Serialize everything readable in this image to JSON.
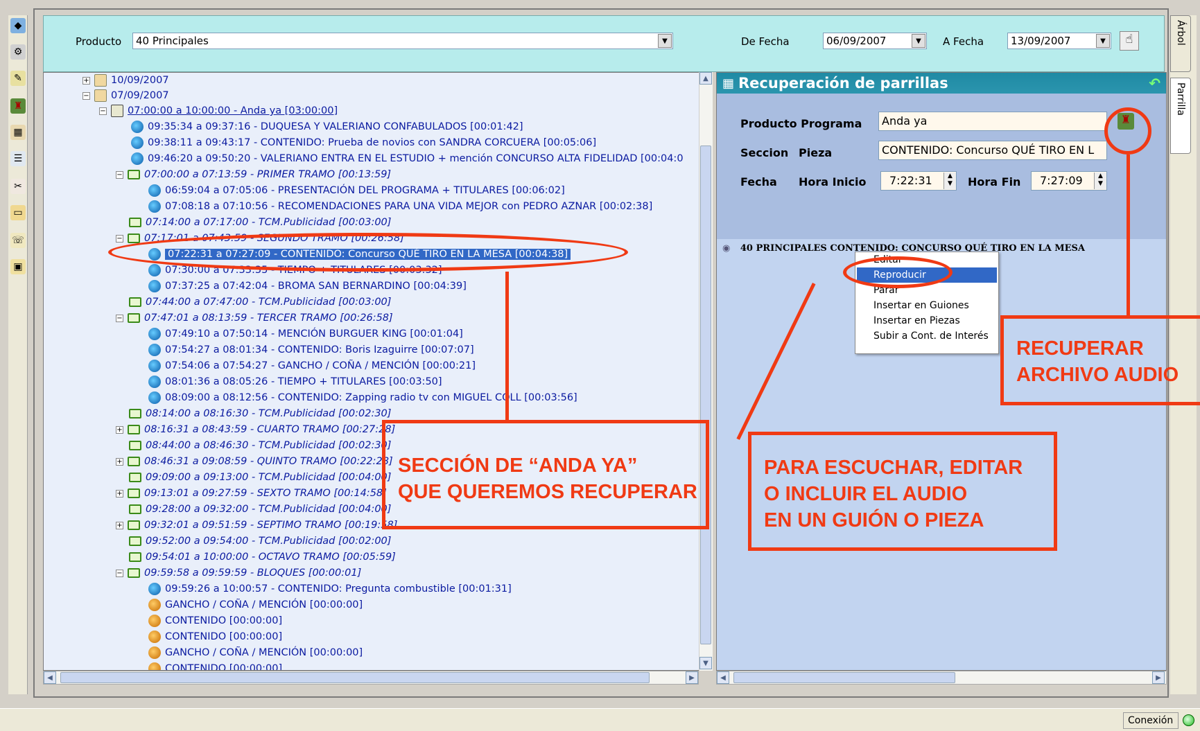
{
  "filter": {
    "producto_label": "Producto",
    "producto_value": "40 Principales",
    "de_fecha_label": "De Fecha",
    "de_fecha_value": "06/09/2007",
    "a_fecha_label": "A Fecha",
    "a_fecha_value": "13/09/2007"
  },
  "tree": {
    "rows": [
      {
        "text": "10/09/2007"
      },
      {
        "text": "07/09/2007"
      },
      {
        "text": "07:00:00 a 10:00:00 - Anda ya [03:00:00]"
      },
      {
        "text": "09:35:34 a 09:37:16 - DUQUESA Y VALERIANO CONFABULADOS [00:01:42]"
      },
      {
        "text": "09:38:11 a 09:43:17 - CONTENIDO: Prueba de novios con SANDRA CORCUERA [00:05:06]"
      },
      {
        "text": "09:46:20 a 09:50:20 - VALERIANO ENTRA EN EL ESTUDIO + mención CONCURSO ALTA FIDELIDAD [00:04:0"
      },
      {
        "text": "07:00:00 a 07:13:59 - PRIMER TRAMO [00:13:59]"
      },
      {
        "text": "06:59:04 a 07:05:06 - PRESENTACIÓN DEL PROGRAMA + TITULARES [00:06:02]"
      },
      {
        "text": "07:08:18 a 07:10:56 - RECOMENDACIONES PARA UNA VIDA MEJOR con PEDRO AZNAR [00:02:38]"
      },
      {
        "text": "07:14:00 a 07:17:00 - TCM.Publicidad [00:03:00]"
      },
      {
        "text": "07:17:01 a 07:43:59 - SEGUNDO TRAMO [00:26:58]"
      },
      {
        "text": "07:22:31 a 07:27:09 - CONTENIDO: Concurso QUÉ TIRO EN LA MESA [00:04:38]"
      },
      {
        "text": "07:30:00 a 07:33:35 - TIEMPO + TITULARES [00:03:32]"
      },
      {
        "text": "07:37:25 a 07:42:04 - BROMA SAN BERNARDINO [00:04:39]"
      },
      {
        "text": "07:44:00 a 07:47:00 - TCM.Publicidad [00:03:00]"
      },
      {
        "text": "07:47:01 a 08:13:59 - TERCER TRAMO [00:26:58]"
      },
      {
        "text": "07:49:10 a 07:50:14 - MENCIÓN BURGUER KING [00:01:04]"
      },
      {
        "text": "07:54:27 a 08:01:34 - CONTENIDO: Boris Izaguirre [00:07:07]"
      },
      {
        "text": "07:54:06 a 07:54:27 - GANCHO / COÑA / MENCIÓN [00:00:21]"
      },
      {
        "text": "08:01:36 a 08:05:26 - TIEMPO + TITULARES [00:03:50]"
      },
      {
        "text": "08:09:00 a 08:12:56 - CONTENIDO: Zapping radio tv con MIGUEL COLL [00:03:56]"
      },
      {
        "text": "08:14:00 a 08:16:30 - TCM.Publicidad [00:02:30]"
      },
      {
        "text": "08:16:31 a 08:43:59 - CUARTO TRAMO [00:27:28]"
      },
      {
        "text": "08:44:00 a 08:46:30 - TCM.Publicidad [00:02:30]"
      },
      {
        "text": "08:46:31 a 09:08:59 - QUINTO TRAMO [00:22:28]"
      },
      {
        "text": "09:09:00 a 09:13:00 - TCM.Publicidad [00:04:00]"
      },
      {
        "text": "09:13:01 a 09:27:59 - SEXTO TRAMO [00:14:58]"
      },
      {
        "text": "09:28:00 a 09:32:00 - TCM.Publicidad [00:04:00]"
      },
      {
        "text": "09:32:01 a 09:51:59 - SEPTIMO TRAMO [00:19:58]"
      },
      {
        "text": "09:52:00 a 09:54:00 - TCM.Publicidad [00:02:00]"
      },
      {
        "text": "09:54:01 a 10:00:00 - OCTAVO TRAMO [00:05:59]"
      },
      {
        "text": "09:59:58 a 09:59:59 - BLOQUES [00:00:01]"
      },
      {
        "text": "09:59:26 a 10:00:57 - CONTENIDO: Pregunta combustible [00:01:31]"
      },
      {
        "text": "GANCHO / COÑA / MENCIÓN [00:00:00]"
      },
      {
        "text": "CONTENIDO [00:00:00]"
      },
      {
        "text": "CONTENIDO [00:00:00]"
      },
      {
        "text": "GANCHO / COÑA / MENCIÓN [00:00:00]"
      },
      {
        "text": "CONTENIDO [00:00:00]"
      }
    ]
  },
  "right_panel": {
    "title": "Recuperación de parrillas",
    "producto_programa_label": "Producto Programa",
    "producto_programa_value": "Anda ya",
    "seccion_label": "Seccion",
    "pieza_label": "Pieza",
    "seccion_value": "CONTENIDO: Concurso QUÉ TIRO EN L",
    "fecha_label": "Fecha",
    "hora_inicio_label": "Hora Inicio",
    "hora_inicio_value": "7:22:31",
    "hora_fin_label": "Hora Fin",
    "hora_fin_value": "7:27:09",
    "log_text": "40 PRINCIPALES CONTENIDO: CONCURSO QUÉ TIRO EN LA MESA"
  },
  "context_menu": {
    "items": [
      "Editar",
      "Reproducir",
      "Parar",
      "Insertar en Guiones",
      "Insertar en Piezas",
      "Subir a Cont. de Interés"
    ]
  },
  "vtabs": {
    "arbol": "Árbol",
    "parrilla": "Parrilla"
  },
  "status": {
    "connection": "Conexión"
  },
  "annotations": {
    "recuperar_line1": "RECUPERAR",
    "recuperar_line2": "ARCHIVO AUDIO",
    "seccion_line1": "SECCIÓN DE “ANDA YA”",
    "seccion_line2": "QUE QUEREMOS RECUPERAR",
    "escuchar_line1": "PARA ESCUCHAR, EDITAR",
    "escuchar_line2": "O INCLUIR EL AUDIO",
    "escuchar_line3": "EN UN GUIÓN O PIEZA"
  },
  "colors": {
    "annotation": "#f03a14",
    "selection": "#3168c6",
    "header": "#1f8aa4",
    "filter_bg": "#b7ecec"
  }
}
